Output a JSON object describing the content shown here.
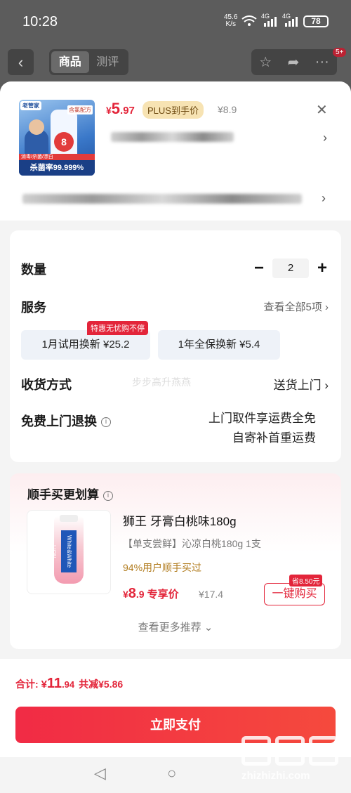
{
  "status": {
    "time": "10:28",
    "net_speed_value": "45.6",
    "net_speed_unit": "K/s",
    "signal_label_1": "4G",
    "signal_label_2": "4G",
    "battery": "78"
  },
  "header": {
    "tabs": [
      {
        "label": "商品"
      },
      {
        "label": "测评"
      }
    ],
    "cart_badge": "5+"
  },
  "product": {
    "price_currency": "¥",
    "price_int": "5",
    "price_dec": ".97",
    "plus_label": "PLUS到手价",
    "original_price": "¥8.9",
    "image_texts": {
      "logo": "老管家",
      "label": "含氯配方",
      "count": "8",
      "sub": "消毒/杀菌/漂白",
      "strip": "杀菌率99.999%"
    }
  },
  "options": {
    "quantity_label": "数量",
    "quantity_value": "2",
    "minus": "−",
    "plus": "+",
    "service_label": "服务",
    "service_view_all": "查看全部5项",
    "service_options": [
      {
        "label": "1月试用换新 ¥25.2",
        "tag": "特惠无忧购不停"
      },
      {
        "label": "1年全保换新 ¥5.4"
      }
    ],
    "delivery_label": "收货方式",
    "delivery_value": "送货上门",
    "delivery_ghost": "步步高升燕燕",
    "return_label": "免费上门退换",
    "return_line1": "上门取件享运费全免",
    "return_line2": "自寄补首重运费"
  },
  "bundle": {
    "title": "顺手买更划算",
    "item_name": "狮王 牙膏白桃味180g",
    "item_sub": "【单支尝鲜】沁凉白桃180g 1支",
    "buy_ratio": "94%用户顺手买过",
    "price_currency": "¥",
    "price_int": "8",
    "price_dec": ".9",
    "price_label": "专享价",
    "orig_price": "¥17.4",
    "save_tag": "省8.50元",
    "buy_button": "一键购买",
    "more": "查看更多推荐",
    "tube_text": "White&White LION"
  },
  "footer": {
    "total_label": "合计: ",
    "total_currency": "¥",
    "total_int": "11",
    "total_dec": ".94",
    "discount": "共减¥5.86",
    "pay_button": "立即支付"
  },
  "watermark": {
    "url": "zhizhizhi.com"
  }
}
